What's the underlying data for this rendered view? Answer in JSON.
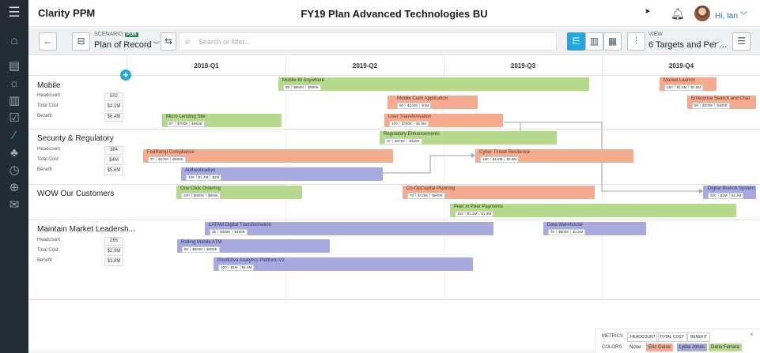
{
  "header": {
    "brand": "Clarity PPM",
    "title": "FY19 Plan Advanced Technologies BU",
    "user": "Hi, Ian ﹀"
  },
  "toolbar": {
    "scenario_label": "SCENARIO",
    "scenario_badge": "POR",
    "scenario_value": "Plan of Record",
    "search_placeholder": "Search or filter...",
    "view_label": "VIEW",
    "view_value": "6 Targets and Per ..."
  },
  "quarters": [
    "2019-Q1",
    "2019-Q2",
    "2019-Q3",
    "2019-Q4"
  ],
  "rows": [
    {
      "name": "Mobile",
      "metrics": [
        {
          "label": "Headcount",
          "value": "502"
        },
        {
          "label": "Total Cost",
          "value": "$4.1M"
        },
        {
          "label": "Benefit",
          "value": "$6.4M"
        }
      ]
    },
    {
      "name": "Security & Regulatory",
      "metrics": [
        {
          "label": "Headcount",
          "value": "384"
        },
        {
          "label": "Total Cost",
          "value": "$4M"
        },
        {
          "label": "Benefit",
          "value": "$5.6M"
        }
      ]
    },
    {
      "name": "WOW Our Customers",
      "metrics": []
    },
    {
      "name": "Maintain Market Leadersh...",
      "metrics": [
        {
          "label": "Headcount",
          "value": "265"
        },
        {
          "label": "Total Cost",
          "value": "$2.9M"
        },
        {
          "label": "Benefit",
          "value": "$3.8M"
        }
      ]
    }
  ],
  "initiatives": [
    {
      "title": "Mobile BI Anywhere",
      "metrics": [
        "85",
        "$850K",
        "$950K"
      ],
      "color": "green"
    },
    {
      "title": "Market Launch",
      "metrics": [
        "150",
        "$1.5M",
        "$1.8M"
      ],
      "color": "salmon"
    },
    {
      "title": "Mobile Cash Application",
      "metrics": [
        "50",
        "$140K",
        "$1M"
      ],
      "color": "salmon"
    },
    {
      "title": "Enterprise Search and Chat",
      "metrics": [
        "20",
        "$200K",
        "$300K"
      ],
      "color": "salmon"
    },
    {
      "title": "Micro Lending Site",
      "metrics": [
        "97",
        "$700K",
        "$850K"
      ],
      "color": "green"
    },
    {
      "title": "User Transformation",
      "metrics": [
        "100",
        "$700K",
        "$1.5M"
      ],
      "color": "salmon"
    },
    {
      "title": "Regulatory Enhancements",
      "metrics": [
        "37",
        "$375K",
        "$425K"
      ],
      "color": "green"
    },
    {
      "title": "FedRamp Compliance",
      "metrics": [
        "37",
        "$375K",
        "$650K"
      ],
      "color": "salmon"
    },
    {
      "title": "Cyber Threat Resilience",
      "metrics": [
        "190",
        "$1.9M",
        "$2.5M"
      ],
      "color": "salmon"
    },
    {
      "title": "Authentication",
      "metrics": [
        "100",
        "$1.1M",
        "$2M"
      ],
      "color": "blue"
    },
    {
      "title": "One Click Ordering",
      "metrics": [
        "100",
        "$650K",
        "$800K"
      ],
      "color": "green"
    },
    {
      "title": "Co-OpCapital Planning",
      "metrics": [
        "70",
        "$725K",
        "$900K"
      ],
      "color": "salmon"
    },
    {
      "title": "Digital Branch System",
      "metrics": [
        "100",
        "$1M",
        "$1.3M"
      ],
      "color": "blue"
    },
    {
      "title": "Peer to Peer Payments",
      "metrics": [
        "155",
        "$1.6M",
        "$1.8M"
      ],
      "color": "green"
    },
    {
      "title": "LATAM Digital Transformation",
      "metrics": [
        "35",
        "$350K",
        "$450K"
      ],
      "color": "blue"
    },
    {
      "title": "Data Warehouse",
      "metrics": [
        "70",
        "$900K",
        "$1.2M"
      ],
      "color": "blue"
    },
    {
      "title": "Rolling Mobile ATM",
      "metrics": [
        "60",
        "$600K",
        "$800K"
      ],
      "color": "blue"
    },
    {
      "title": "Predictive Analytics Platform V2",
      "metrics": [
        "100",
        "$1M",
        "$1.4M"
      ],
      "color": "blue"
    }
  ],
  "legend": {
    "metrics_label": "METRICS",
    "metric_chips": [
      "HEADCOUNT",
      "TOTAL COST",
      "BENEFIT"
    ],
    "colors_label": "COLORS",
    "color_chips": [
      {
        "label": "None",
        "color": "#ffffff"
      },
      {
        "label": "Eric Guise",
        "color": "#f5ab8e"
      },
      {
        "label": "Lydia Jones",
        "color": "#a8aadf"
      },
      {
        "label": "Dario Ferrara",
        "color": "#b6d98d"
      }
    ],
    "close": "×"
  }
}
